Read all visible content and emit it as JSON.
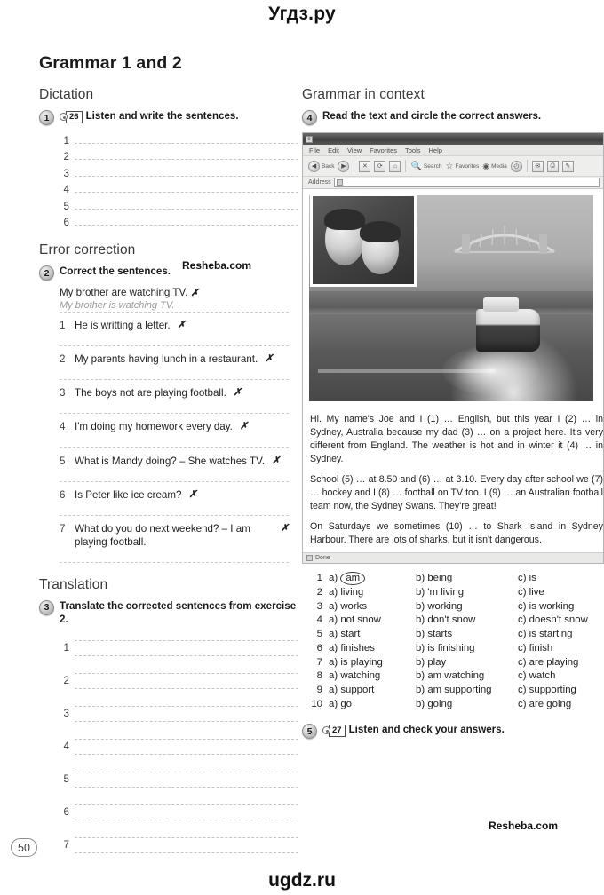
{
  "watermarks": {
    "top": "Угдз.ру",
    "bottom": "ugdz.ru",
    "resheba_1": "Resheba.com",
    "resheba_2": "Resheba.com"
  },
  "page": {
    "title": "Grammar 1 and 2",
    "number": "50"
  },
  "left_column": {
    "dictation": {
      "heading": "Dictation",
      "exercise": {
        "number": "1",
        "audio_icon": "cd-icon",
        "track": "26",
        "instruction": "Listen and write the sentences."
      },
      "line_numbers": [
        "1",
        "2",
        "3",
        "4",
        "5",
        "6"
      ]
    },
    "error_correction": {
      "heading": "Error correction",
      "exercise": {
        "number": "2",
        "instruction": "Correct the sentences."
      },
      "example": {
        "prompt": "My brother are watching TV.",
        "mark": "✗",
        "answer": "My brother is watching TV."
      },
      "items": [
        {
          "number": "1",
          "text": "He is writting a letter.",
          "mark": "✗"
        },
        {
          "number": "2",
          "text": "My parents having lunch in a restaurant.",
          "mark": "✗"
        },
        {
          "number": "3",
          "text": "The boys not are playing football.",
          "mark": "✗"
        },
        {
          "number": "4",
          "text": "I'm doing my homework every day.",
          "mark": "✗"
        },
        {
          "number": "5",
          "text": "What is Mandy doing? – She watches TV.",
          "mark": "✗"
        },
        {
          "number": "6",
          "text": "Is Peter like ice cream?",
          "mark": "✗"
        },
        {
          "number": "7",
          "text": "What do you do next weekend? – I am playing football.",
          "mark": "✗"
        }
      ]
    },
    "translation": {
      "heading": "Translation",
      "exercise": {
        "number": "3",
        "instruction": "Translate the corrected sentences from exercise 2."
      },
      "line_numbers": [
        "1",
        "2",
        "3",
        "4",
        "5",
        "6",
        "7"
      ]
    }
  },
  "right_column": {
    "heading": "Grammar in context",
    "exercise4": {
      "number": "4",
      "instruction": "Read the text and circle the correct answers."
    },
    "browser": {
      "menus": [
        "File",
        "Edit",
        "View",
        "Favorites",
        "Tools",
        "Help"
      ],
      "toolbar": [
        {
          "icon": "back-arrow-icon",
          "label": "Back"
        },
        {
          "icon": "forward-arrow-icon",
          "label": ""
        },
        {
          "icon": "stop-icon",
          "label": ""
        },
        {
          "icon": "refresh-icon",
          "label": ""
        },
        {
          "icon": "home-icon",
          "label": ""
        },
        {
          "icon": "search-icon",
          "label": "Search"
        },
        {
          "icon": "star-favorites-icon",
          "label": "Favorites"
        },
        {
          "icon": "media-icon",
          "label": "Media"
        },
        {
          "icon": "history-icon",
          "label": ""
        },
        {
          "icon": "mail-icon",
          "label": ""
        },
        {
          "icon": "print-icon",
          "label": ""
        },
        {
          "icon": "edit-page-icon",
          "label": ""
        }
      ],
      "address_label": "Address",
      "address_value": "",
      "status": "Done",
      "photo_caption": "Sydney Harbour Bridge with ferry, inset portrait of father and son"
    },
    "reading_text": [
      "Hi. My name's Joe and I (1) … English, but this year I (2) … in Sydney, Australia because my dad (3) … on a project here. It's very different from England. The weather is hot and in winter it (4) … in Sydney.",
      "School (5) … at 8.50 and (6) … at 3.10. Every day after school we (7) … hockey and I (8) … football on TV too. I (9) … an Australian football team now, the Sydney Swans. They're great!",
      "On Saturdays we sometimes (10) … to Shark Island in Sydney Harbour. There are lots of sharks, but it isn't dangerous."
    ],
    "options": [
      {
        "n": "1",
        "a": "am",
        "b": "being",
        "c": "is",
        "circled": "a"
      },
      {
        "n": "2",
        "a": "living",
        "b": "'m living",
        "c": "live",
        "circled": ""
      },
      {
        "n": "3",
        "a": "works",
        "b": "working",
        "c": "is working",
        "circled": ""
      },
      {
        "n": "4",
        "a": "not snow",
        "b": "don't snow",
        "c": "doesn't snow",
        "circled": ""
      },
      {
        "n": "5",
        "a": "start",
        "b": "starts",
        "c": "is starting",
        "circled": ""
      },
      {
        "n": "6",
        "a": "finishes",
        "b": "is finishing",
        "c": "finish",
        "circled": ""
      },
      {
        "n": "7",
        "a": "is playing",
        "b": "play",
        "c": "are playing",
        "circled": ""
      },
      {
        "n": "8",
        "a": "watching",
        "b": "am watching",
        "c": "watch",
        "circled": ""
      },
      {
        "n": "9",
        "a": "support",
        "b": "am supporting",
        "c": "supporting",
        "circled": ""
      },
      {
        "n": "10",
        "a": "go",
        "b": "going",
        "c": "are going",
        "circled": ""
      }
    ],
    "option_prefixes": {
      "a": "a)",
      "b": "b)",
      "c": "c)"
    },
    "exercise5": {
      "number": "5",
      "audio_icon": "cd-icon",
      "track": "27",
      "instruction": "Listen and check your answers."
    }
  }
}
